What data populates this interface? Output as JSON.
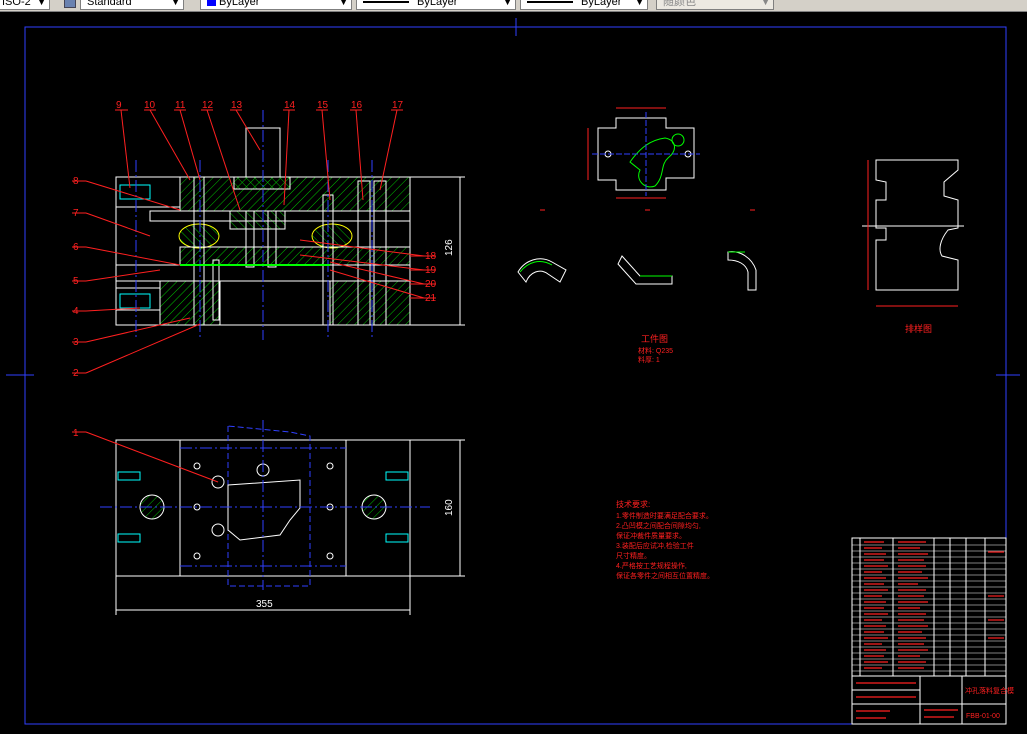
{
  "toolbar": {
    "dimstyle": "ISO-2",
    "tablestyle": "Standard",
    "layer_color": "ByLayer",
    "linetype": "ByLayer",
    "lineweight": "ByLayer",
    "plotstyle": "随颜色"
  },
  "drawing": {
    "callouts_top": [
      "9",
      "10",
      "11",
      "12",
      "13",
      "14",
      "15",
      "16",
      "17"
    ],
    "callouts_left": [
      "8",
      "7",
      "6",
      "5",
      "4",
      "3",
      "2"
    ],
    "callouts_right": [
      "18",
      "19",
      "20",
      "21"
    ],
    "callout_plan": "1",
    "dim_height_section": "126",
    "dim_height_plan": "160",
    "dim_width_plan": "355",
    "part_view_title": "工件图",
    "part_view_material": "材料: Q235",
    "part_view_thickness": "料厚: 1",
    "strip_view_title": "排样图",
    "tech_title": "技术要求:",
    "tech_notes": [
      "1.零件制造时要满足配合要求。",
      "2.凸凹模之间配合间隙均匀,",
      "保证冲裁件质量要求。",
      "3.装配后应试冲,检验工件",
      "尺寸精度。",
      "4.严格按工艺规程操作,",
      "保证各零件之间相互位置精度。"
    ],
    "title_block_name": "冲孔落料复合模",
    "drawing_number": "FBB-01-00"
  }
}
